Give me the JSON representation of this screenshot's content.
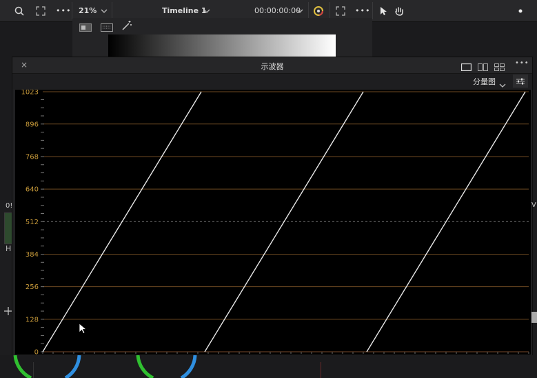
{
  "toolbar": {
    "zoom": "21%",
    "timeline": "Timeline 1",
    "timecode": "00:00:00:00"
  },
  "scope": {
    "title": "示波器",
    "mode": "分量图",
    "y_ticks": [
      "1023",
      "896",
      "768",
      "640",
      "512",
      "384",
      "256",
      "128",
      "0"
    ]
  },
  "left_partial": {
    "label_a": "0!",
    "label_b": "H."
  },
  "right_partial": {
    "label": "V"
  },
  "chart_data": {
    "type": "line",
    "title": "",
    "ylim": [
      0,
      1023
    ],
    "yticks": [
      0,
      128,
      256,
      384,
      512,
      640,
      768,
      896,
      1023
    ],
    "series": [
      {
        "x": [
          0,
          1
        ],
        "y": [
          0,
          1023
        ]
      },
      {
        "x": [
          0,
          1
        ],
        "y": [
          0,
          1023
        ]
      },
      {
        "x": [
          0,
          1
        ],
        "y": [
          0,
          1023
        ]
      }
    ]
  }
}
